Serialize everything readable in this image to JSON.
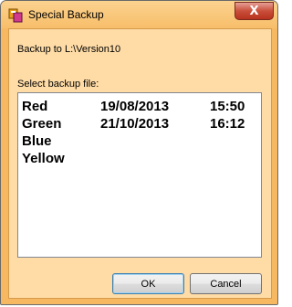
{
  "window": {
    "title": "Special Backup",
    "close_label": "X"
  },
  "backup_to": "Backup to L:\\Version10",
  "select_label": "Select backup file:",
  "files": [
    {
      "name": "Red",
      "date": "19/08/2013",
      "time": "15:50"
    },
    {
      "name": "Green",
      "date": "21/10/2013",
      "time": "16:12"
    },
    {
      "name": "Blue",
      "date": "",
      "time": ""
    },
    {
      "name": "Yellow",
      "date": "",
      "time": ""
    }
  ],
  "buttons": {
    "ok": "OK",
    "cancel": "Cancel"
  },
  "colors": {
    "window_frame": "#f6b961",
    "client_background": "#ffdca6",
    "close_button": "#c94f3b"
  },
  "icons": {
    "app": "app-icon",
    "close": "close-icon"
  }
}
